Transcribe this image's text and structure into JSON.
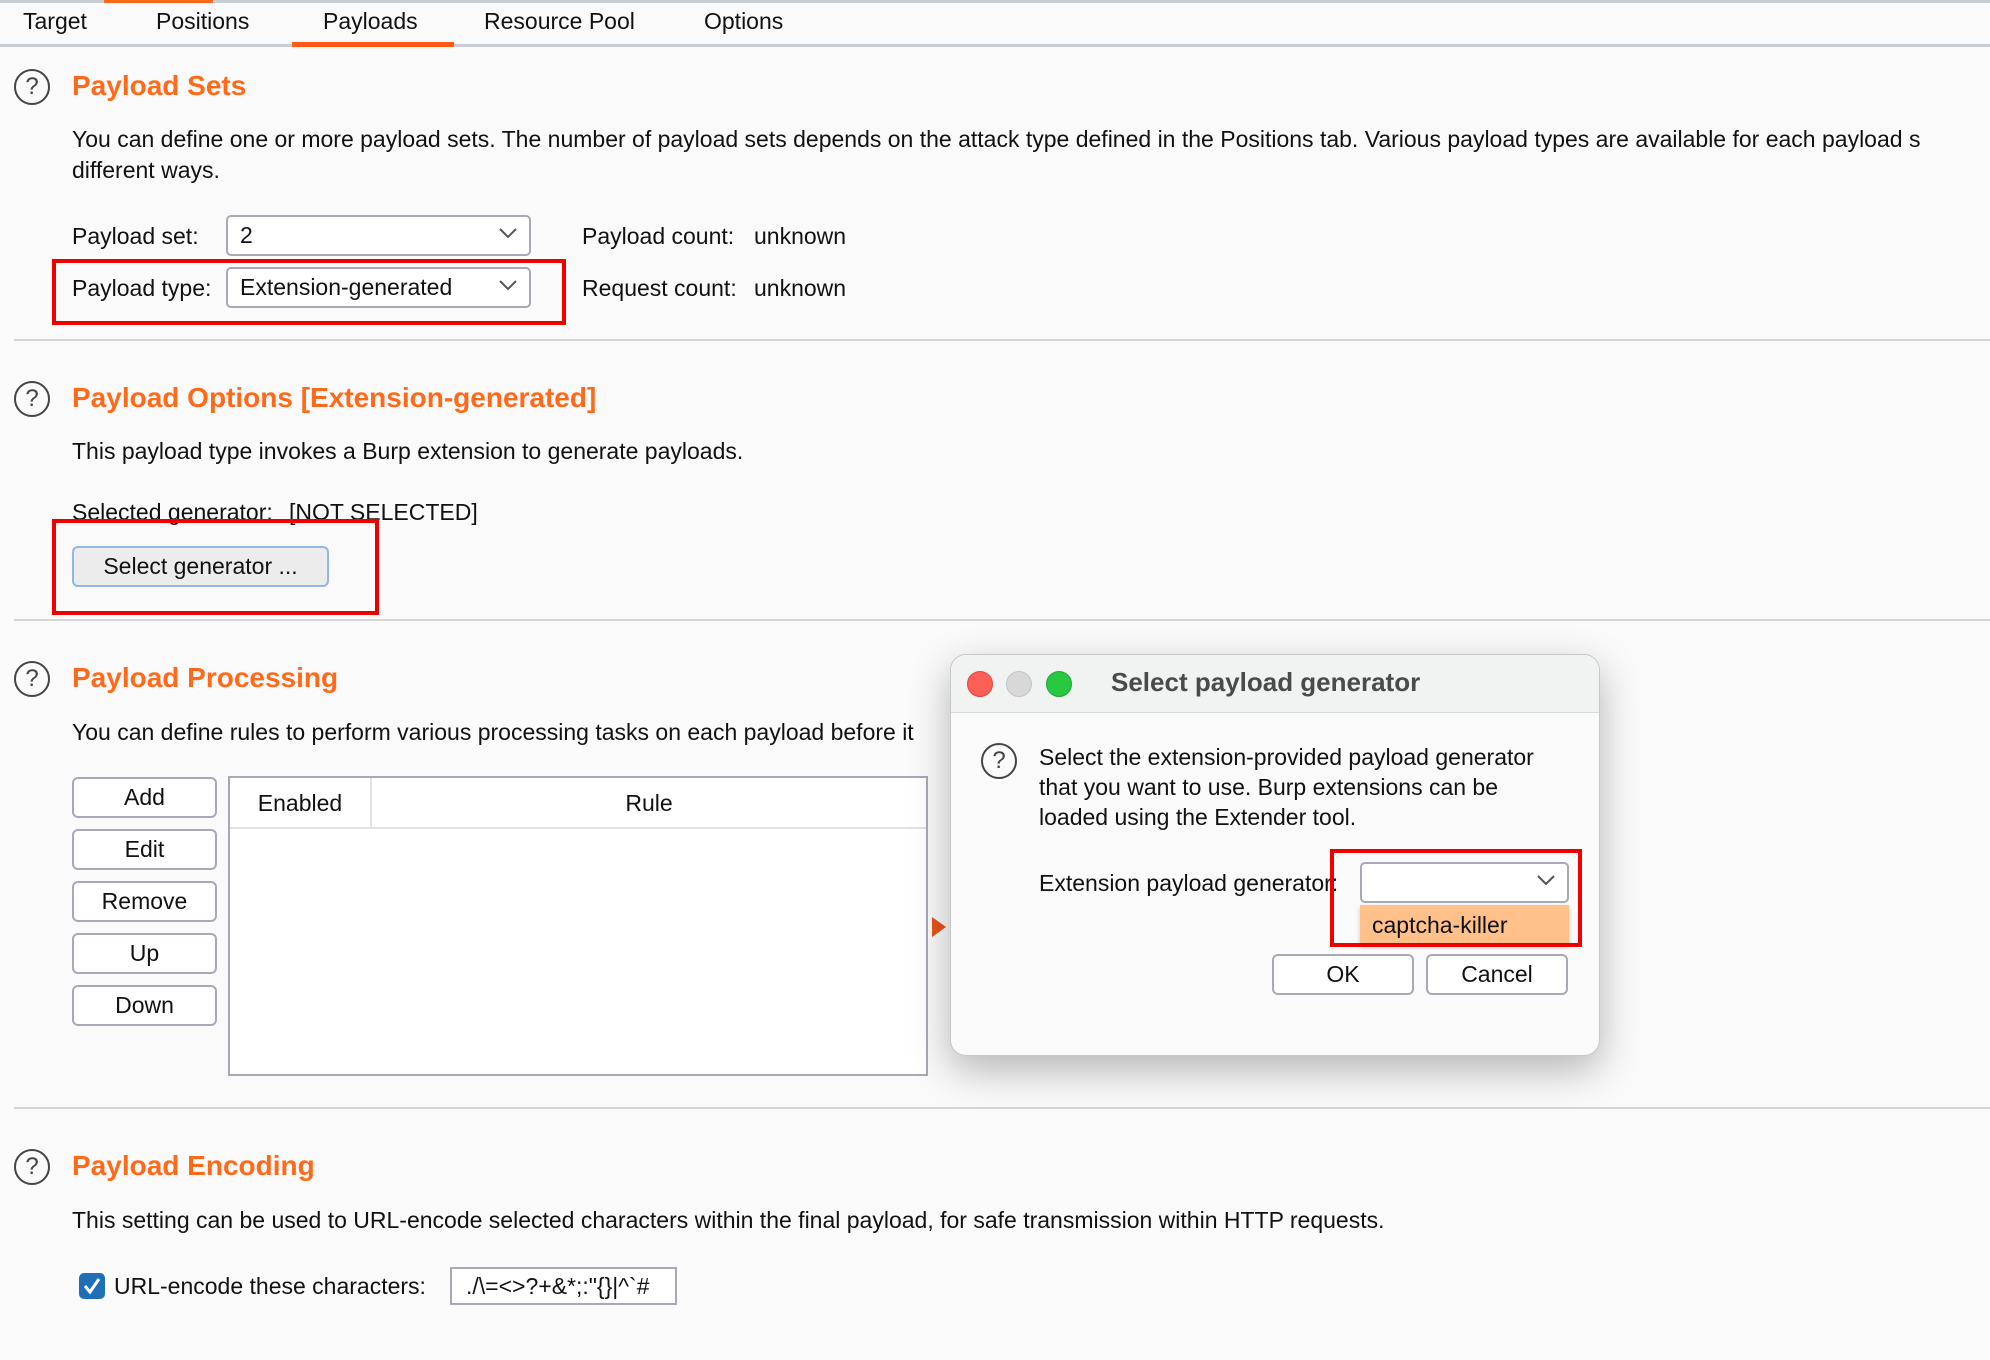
{
  "tabs": [
    {
      "label": "Target",
      "active": false
    },
    {
      "label": "Positions",
      "active": false
    },
    {
      "label": "Payloads",
      "active": true
    },
    {
      "label": "Resource Pool",
      "active": false
    },
    {
      "label": "Options",
      "active": false
    }
  ],
  "colors": {
    "accent": "#ff6a1a",
    "highlight_box": "#ee0000",
    "dropdown_highlight": "#ffc08a",
    "checkbox": "#1f6fb6"
  },
  "payload_sets": {
    "heading": "Payload Sets",
    "description_line1": "You can define one or more payload sets. The number of payload sets depends on the attack type defined in the Positions tab. Various payload types are available for each payload s",
    "description_line2": "different ways.",
    "payload_set_label": "Payload set:",
    "payload_set_value": "2",
    "payload_type_label": "Payload type:",
    "payload_type_value": "Extension-generated",
    "payload_count_label": "Payload count:",
    "payload_count_value": "unknown",
    "request_count_label": "Request count:",
    "request_count_value": "unknown"
  },
  "payload_options": {
    "heading": "Payload Options [Extension-generated]",
    "description": "This payload type invokes a Burp extension to generate payloads.",
    "selected_generator_label": "Selected generator:",
    "selected_generator_value": "[NOT SELECTED]",
    "select_button": "Select generator ..."
  },
  "payload_processing": {
    "heading": "Payload Processing",
    "description": "You can define rules to perform various processing tasks on each payload before it",
    "buttons": [
      "Add",
      "Edit",
      "Remove",
      "Up",
      "Down"
    ],
    "table_columns": [
      "Enabled",
      "Rule"
    ],
    "rows": []
  },
  "payload_encoding": {
    "heading": "Payload Encoding",
    "description": "This setting can be used to URL-encode selected characters within the final payload, for safe transmission within HTTP requests.",
    "checkbox_label": "URL-encode these characters:",
    "checkbox_checked": true,
    "characters": "./\\=<>?+&*;:\"{}|^`#"
  },
  "dialog": {
    "title": "Select payload generator",
    "description_line1": "Select the extension-provided payload generator",
    "description_line2": "that you want to use. Burp extensions can be",
    "description_line3": "loaded using the Extender tool.",
    "generator_label": "Extension payload generator:",
    "generator_value": "",
    "dropdown_options": [
      "captcha-killer"
    ],
    "ok": "OK",
    "cancel": "Cancel"
  }
}
